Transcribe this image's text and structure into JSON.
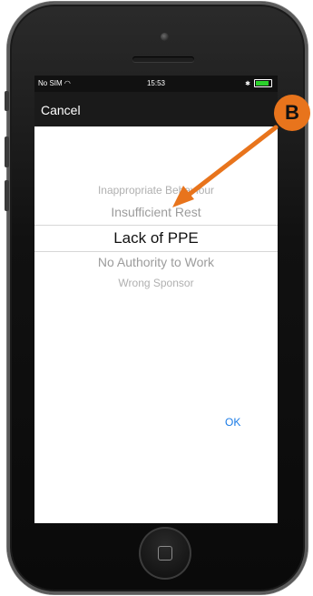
{
  "status_bar": {
    "carrier": "No SIM",
    "time": "15:53"
  },
  "nav_bar": {
    "cancel_label": "Cancel"
  },
  "picker": {
    "options": [
      "Inappropriate Behaviour",
      "Insufficient Rest",
      "Lack of PPE",
      "No Authority to Work",
      "Wrong Sponsor"
    ],
    "selected": "Lack of PPE"
  },
  "ok_label": "OK",
  "callout": {
    "label": "B",
    "color": "#e8741c"
  },
  "colors": {
    "accent": "#1a7be6",
    "battery": "#2bd12b"
  }
}
